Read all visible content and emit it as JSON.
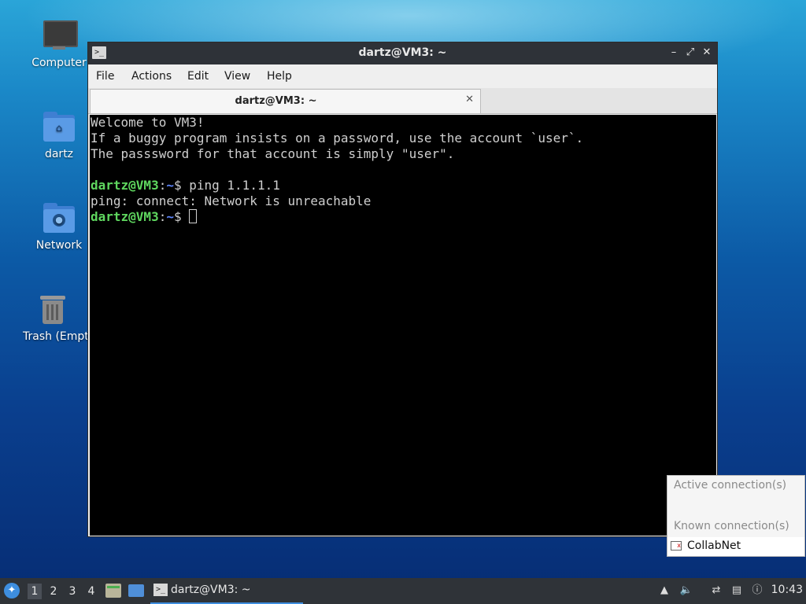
{
  "desktop": {
    "icons": [
      {
        "label": "Computer",
        "icon": "computer-icon"
      },
      {
        "label": "dartz",
        "icon": "home-folder-icon"
      },
      {
        "label": "Network",
        "icon": "network-folder-icon"
      },
      {
        "label": "Trash (Empt",
        "icon": "trash-icon"
      }
    ]
  },
  "window": {
    "title": "dartz@VM3: ~",
    "menu": [
      "File",
      "Actions",
      "Edit",
      "View",
      "Help"
    ],
    "tab": {
      "title": "dartz@VM3: ~"
    },
    "terminal": {
      "lines": [
        "Welcome to VM3!",
        "If a buggy program insists on a password, use the account `user`.",
        "The passsword for that account is simply \"user\"."
      ],
      "prompt_user": "dartz@VM3",
      "prompt_sep": ":",
      "prompt_path": "~",
      "prompt_symbol": "$ ",
      "command": "ping 1.1.1.1",
      "output": "ping: connect: Network is unreachable"
    }
  },
  "network_popup": {
    "active_header": "Active connection(s)",
    "known_header": "Known connection(s)",
    "connection": "CollabNet"
  },
  "taskbar": {
    "desktops": [
      "1",
      "2",
      "3",
      "4"
    ],
    "task_label": "dartz@VM3: ~",
    "clock": "10:43"
  }
}
